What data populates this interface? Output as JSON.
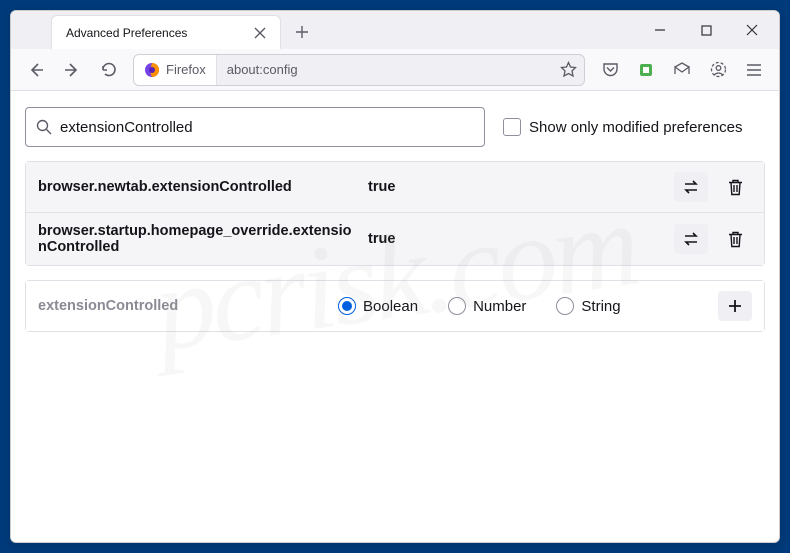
{
  "tab": {
    "title": "Advanced Preferences"
  },
  "urlbar": {
    "chip": "Firefox",
    "address": "about:config"
  },
  "search": {
    "value": "extensionControlled",
    "checkbox_label": "Show only modified preferences"
  },
  "prefs": [
    {
      "name": "browser.newtab.extensionControlled",
      "value": "true"
    },
    {
      "name": "browser.startup.homepage_override.extensionControlled",
      "value": "true"
    }
  ],
  "add_row": {
    "name": "extensionControlled",
    "types": [
      "Boolean",
      "Number",
      "String"
    ],
    "selected": "Boolean"
  },
  "watermark": "pcrisk.com"
}
